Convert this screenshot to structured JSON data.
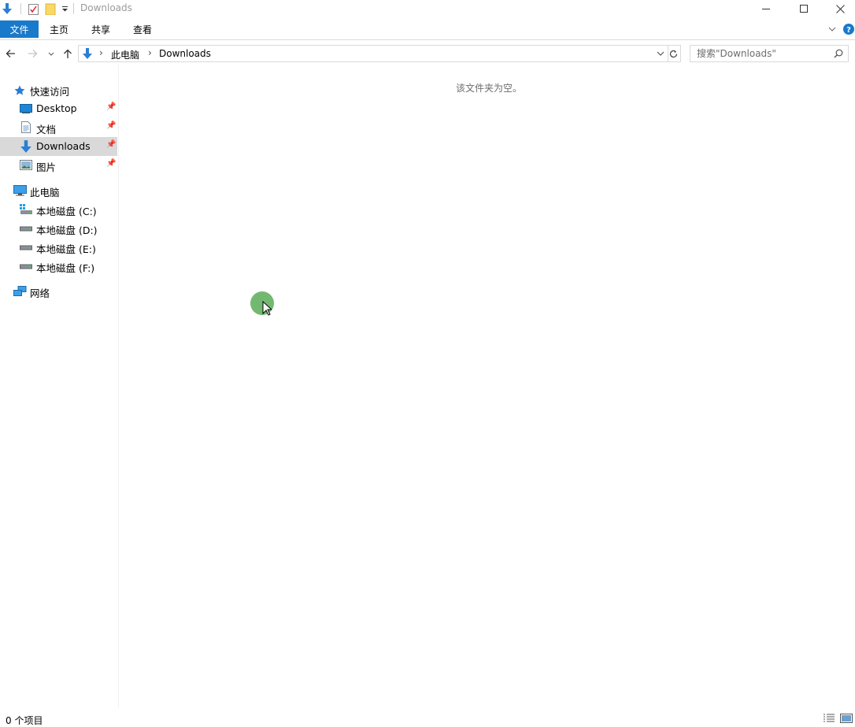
{
  "window": {
    "title": "Downloads"
  },
  "ribbon": {
    "tabs": [
      {
        "label": "文件"
      },
      {
        "label": "主页"
      },
      {
        "label": "共享"
      },
      {
        "label": "查看"
      }
    ]
  },
  "address": {
    "crumbs": [
      "此电脑",
      "Downloads"
    ]
  },
  "search": {
    "placeholder": "搜索\"Downloads\""
  },
  "nav": {
    "quick_access": {
      "label": "快速访问"
    },
    "quick_items": [
      {
        "label": "Desktop"
      },
      {
        "label": "文档"
      },
      {
        "label": "Downloads"
      },
      {
        "label": "图片"
      }
    ],
    "this_pc": {
      "label": "此电脑"
    },
    "drives": [
      {
        "label": "本地磁盘 (C:)"
      },
      {
        "label": "本地磁盘 (D:)"
      },
      {
        "label": "本地磁盘 (E:)"
      },
      {
        "label": "本地磁盘 (F:)"
      }
    ],
    "network": {
      "label": "网络"
    }
  },
  "content": {
    "empty_message": "该文件夹为空。"
  },
  "status": {
    "item_count": "0 个项目"
  },
  "colors": {
    "accent": "#1979ca",
    "selected": "#d9d9d9",
    "folder_blue": "#2a7fd4"
  }
}
